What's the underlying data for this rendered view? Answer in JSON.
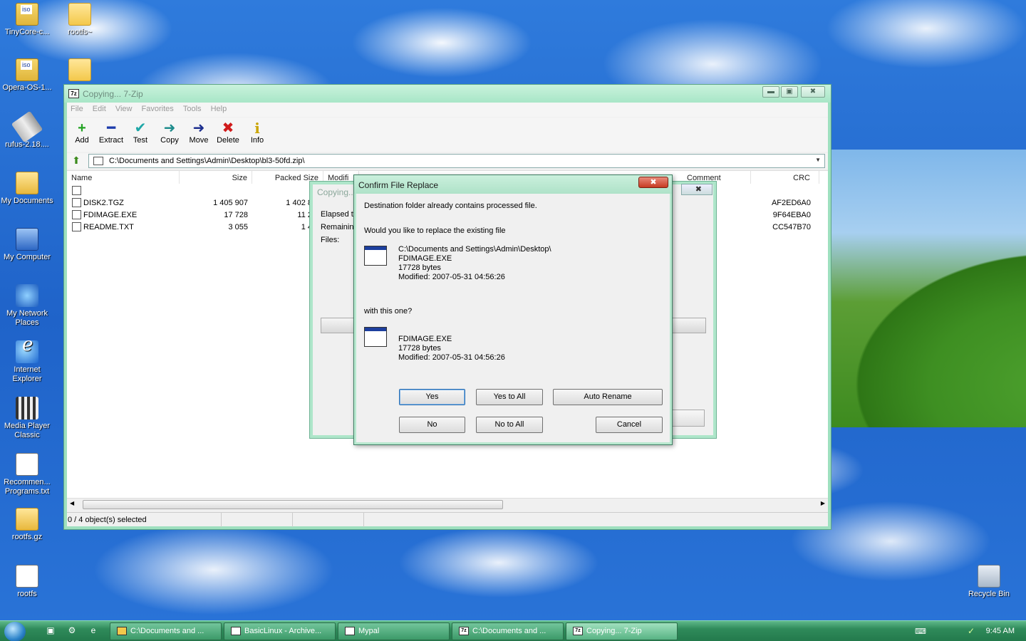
{
  "desktop": {
    "icons": [
      {
        "label": "TinyCore-c...",
        "icon": "iso-file-icon"
      },
      {
        "label": "rootfs~",
        "icon": "folder-icon"
      },
      {
        "label": "Opera-OS-1...",
        "icon": "iso-file-icon"
      },
      {
        "label": "rufus-2.18....",
        "icon": "usb-drive-icon"
      },
      {
        "label": "My Documents",
        "icon": "my-documents-icon"
      },
      {
        "label": "My Computer",
        "icon": "my-computer-icon"
      },
      {
        "label": "My Network Places",
        "icon": "network-places-icon"
      },
      {
        "label": "Internet Explorer",
        "icon": "internet-explorer-icon"
      },
      {
        "label": "Media Player Classic",
        "icon": "media-player-icon"
      },
      {
        "label": "Recommen... Programs.txt",
        "icon": "text-file-icon"
      },
      {
        "label": "rootfs.gz",
        "icon": "gz-archive-icon"
      },
      {
        "label": "rootfs",
        "icon": "file-icon"
      },
      {
        "label": "Recycle Bin",
        "icon": "recycle-bin-icon"
      }
    ]
  },
  "main_window": {
    "title": "Copying... 7-Zip",
    "app_icon_text": "7z",
    "menu": [
      "File",
      "Edit",
      "View",
      "Favorites",
      "Tools",
      "Help"
    ],
    "toolbar": [
      {
        "label": "Add",
        "glyph": "+",
        "color": "#22a322"
      },
      {
        "label": "Extract",
        "glyph": "━",
        "color": "#1d3cab"
      },
      {
        "label": "Test",
        "glyph": "✔",
        "color": "#1ea7a7"
      },
      {
        "label": "Copy",
        "glyph": "➜",
        "color": "#1e8c8c"
      },
      {
        "label": "Move",
        "glyph": "➜",
        "color": "#1d2f8f"
      },
      {
        "label": "Delete",
        "glyph": "✖",
        "color": "#d01b1b"
      },
      {
        "label": "Info",
        "glyph": "i",
        "color": "#c9a400"
      }
    ],
    "address": "C:\\Documents and Settings\\Admin\\Desktop\\bl3-50fd.zip\\",
    "columns": {
      "name": "Name",
      "size": "Size",
      "packed": "Packed Size",
      "modified": "Modifi",
      "comment": "Comment",
      "crc": "CRC"
    },
    "files": [
      {
        "name": "",
        "size": "",
        "packed": "",
        "crc": ""
      },
      {
        "name": "DISK2.TGZ",
        "size": "1 405 907",
        "packed": "1 402 8",
        "crc": "AF2ED6A0"
      },
      {
        "name": "FDIMAGE.EXE",
        "size": "17 728",
        "packed": "11 2",
        "crc": "9F64EBA0"
      },
      {
        "name": "README.TXT",
        "size": "3 055",
        "packed": "1 4",
        "crc": "CC547B70"
      }
    ],
    "status": "0 / 4 object(s) selected"
  },
  "progress_window": {
    "title": "Copying...",
    "elapsed_label": "Elapsed ti",
    "remaining_label": "Remaining",
    "files_label": "Files:"
  },
  "dialog": {
    "title": "Confirm File Replace",
    "close_glyph": "✖",
    "line1": "Destination folder already contains processed file.",
    "line2": "Would you like to replace the existing file",
    "existing": {
      "path": "C:\\Documents and Settings\\Admin\\Desktop\\",
      "name": "FDIMAGE.EXE",
      "size": "17728 bytes",
      "modified": "Modified: 2007-05-31 04:56:26"
    },
    "with_label": "with this one?",
    "replacement": {
      "name": "FDIMAGE.EXE",
      "size": "17728 bytes",
      "modified": "Modified: 2007-05-31 04:56:26"
    },
    "buttons": {
      "yes": "Yes",
      "yes_to_all": "Yes to All",
      "auto_rename": "Auto Rename",
      "no": "No",
      "no_to_all": "No to All",
      "cancel": "Cancel"
    }
  },
  "taskbar": {
    "tasks": [
      {
        "label": "C:\\Documents and ...",
        "icon": "folder-icon",
        "active": false
      },
      {
        "label": "BasicLinux - Archive...",
        "icon": "app-icon",
        "active": false
      },
      {
        "label": "Mypal",
        "icon": "browser-icon",
        "active": false
      },
      {
        "label": "C:\\Documents and ...",
        "icon": "7zip-icon",
        "active": false
      },
      {
        "label": "Copying... 7-Zip",
        "icon": "7zip-icon",
        "active": true
      }
    ],
    "clock": "9:45 AM"
  }
}
